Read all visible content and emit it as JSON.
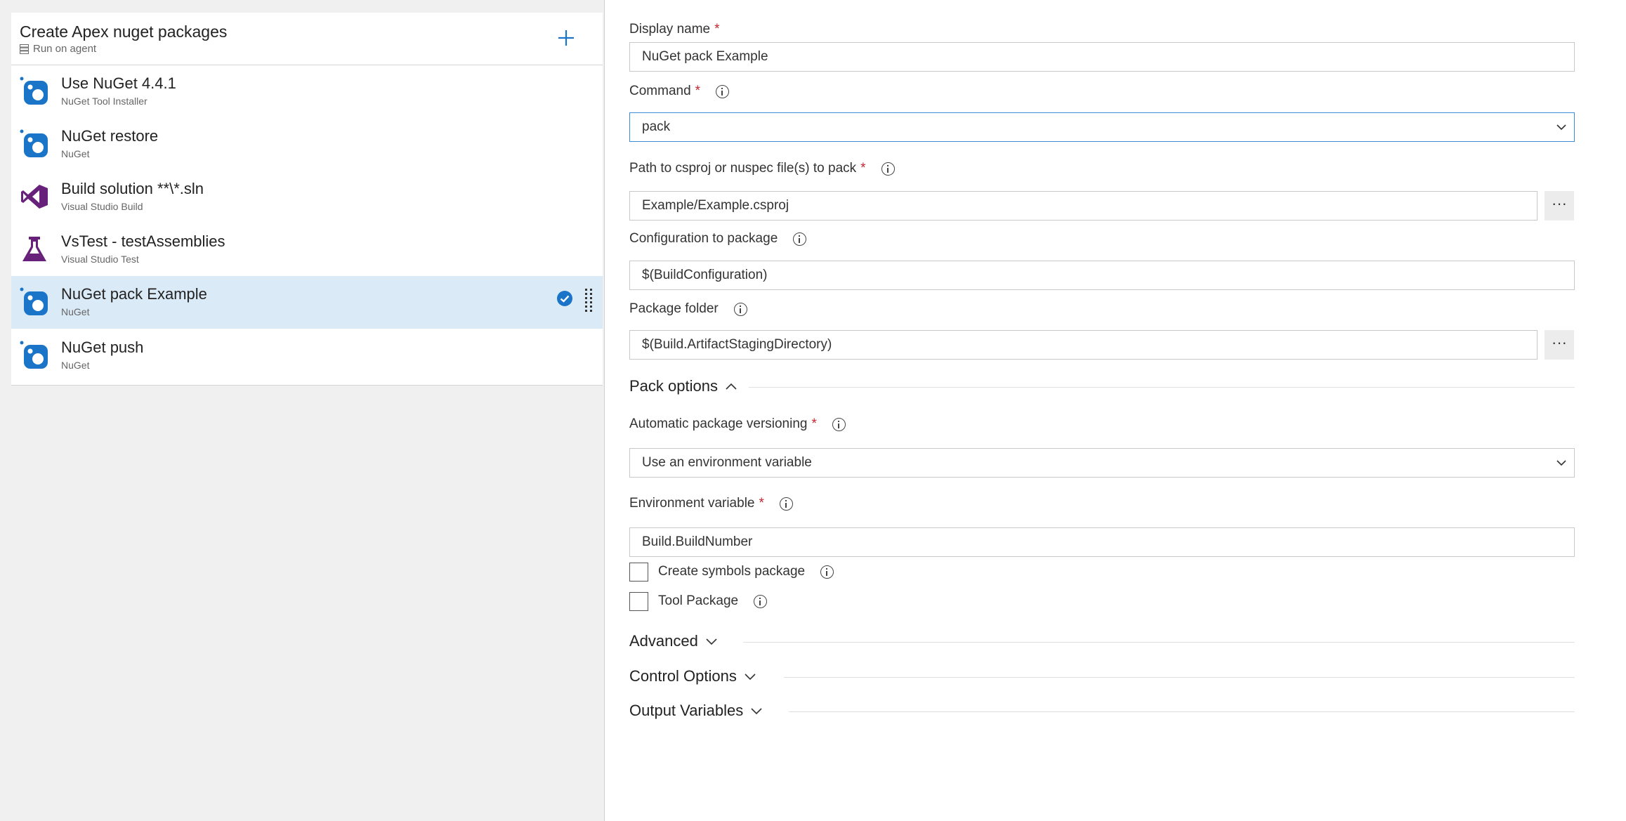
{
  "colors": {
    "accent": "#1a75c8",
    "selected_row": "#dbeaf7",
    "required": "#c4262e",
    "vs_purple": "#68217a"
  },
  "job": {
    "title": "Create Apex nuget packages",
    "subtitle": "Run on agent",
    "add_icon": "plus-icon",
    "subtitle_icon": "agent-server-icon"
  },
  "tasks": [
    {
      "name": "Use NuGet 4.4.1",
      "sub": "NuGet Tool Installer",
      "icon": "nuget-icon"
    },
    {
      "name": "NuGet restore",
      "sub": "NuGet",
      "icon": "nuget-icon"
    },
    {
      "name": "Build solution **\\*.sln",
      "sub": "Visual Studio Build",
      "icon": "visual-studio-icon"
    },
    {
      "name": "VsTest - testAssemblies",
      "sub": "Visual Studio Test",
      "icon": "flask-icon"
    },
    {
      "name": "NuGet pack Example",
      "sub": "NuGet",
      "icon": "nuget-icon",
      "selected": true
    },
    {
      "name": "NuGet push",
      "sub": "NuGet",
      "icon": "nuget-icon"
    }
  ],
  "form": {
    "display_name": {
      "label": "Display name",
      "required": "*",
      "value": "NuGet pack Example"
    },
    "command": {
      "label": "Command",
      "required": "*",
      "value": "pack"
    },
    "path": {
      "label": "Path to csproj or nuspec file(s) to pack",
      "required": "*",
      "value": "Example/Example.csproj",
      "browse": "···"
    },
    "configuration": {
      "label": "Configuration to package",
      "value": "$(BuildConfiguration)"
    },
    "package_folder": {
      "label": "Package folder",
      "value": "$(Build.ArtifactStagingDirectory)",
      "browse": "···"
    },
    "pack_options": {
      "label": "Pack options",
      "expanded": true
    },
    "versioning": {
      "label": "Automatic package versioning",
      "required": "*",
      "value": "Use an environment variable"
    },
    "env_var": {
      "label": "Environment variable",
      "required": "*",
      "value": "Build.BuildNumber"
    },
    "symbols": {
      "label": "Create symbols package",
      "checked": false
    },
    "tool_package": {
      "label": "Tool Package",
      "checked": false
    },
    "advanced": {
      "label": "Advanced",
      "expanded": false
    },
    "control_options": {
      "label": "Control Options",
      "expanded": false
    },
    "output_variables": {
      "label": "Output Variables",
      "expanded": false
    }
  }
}
